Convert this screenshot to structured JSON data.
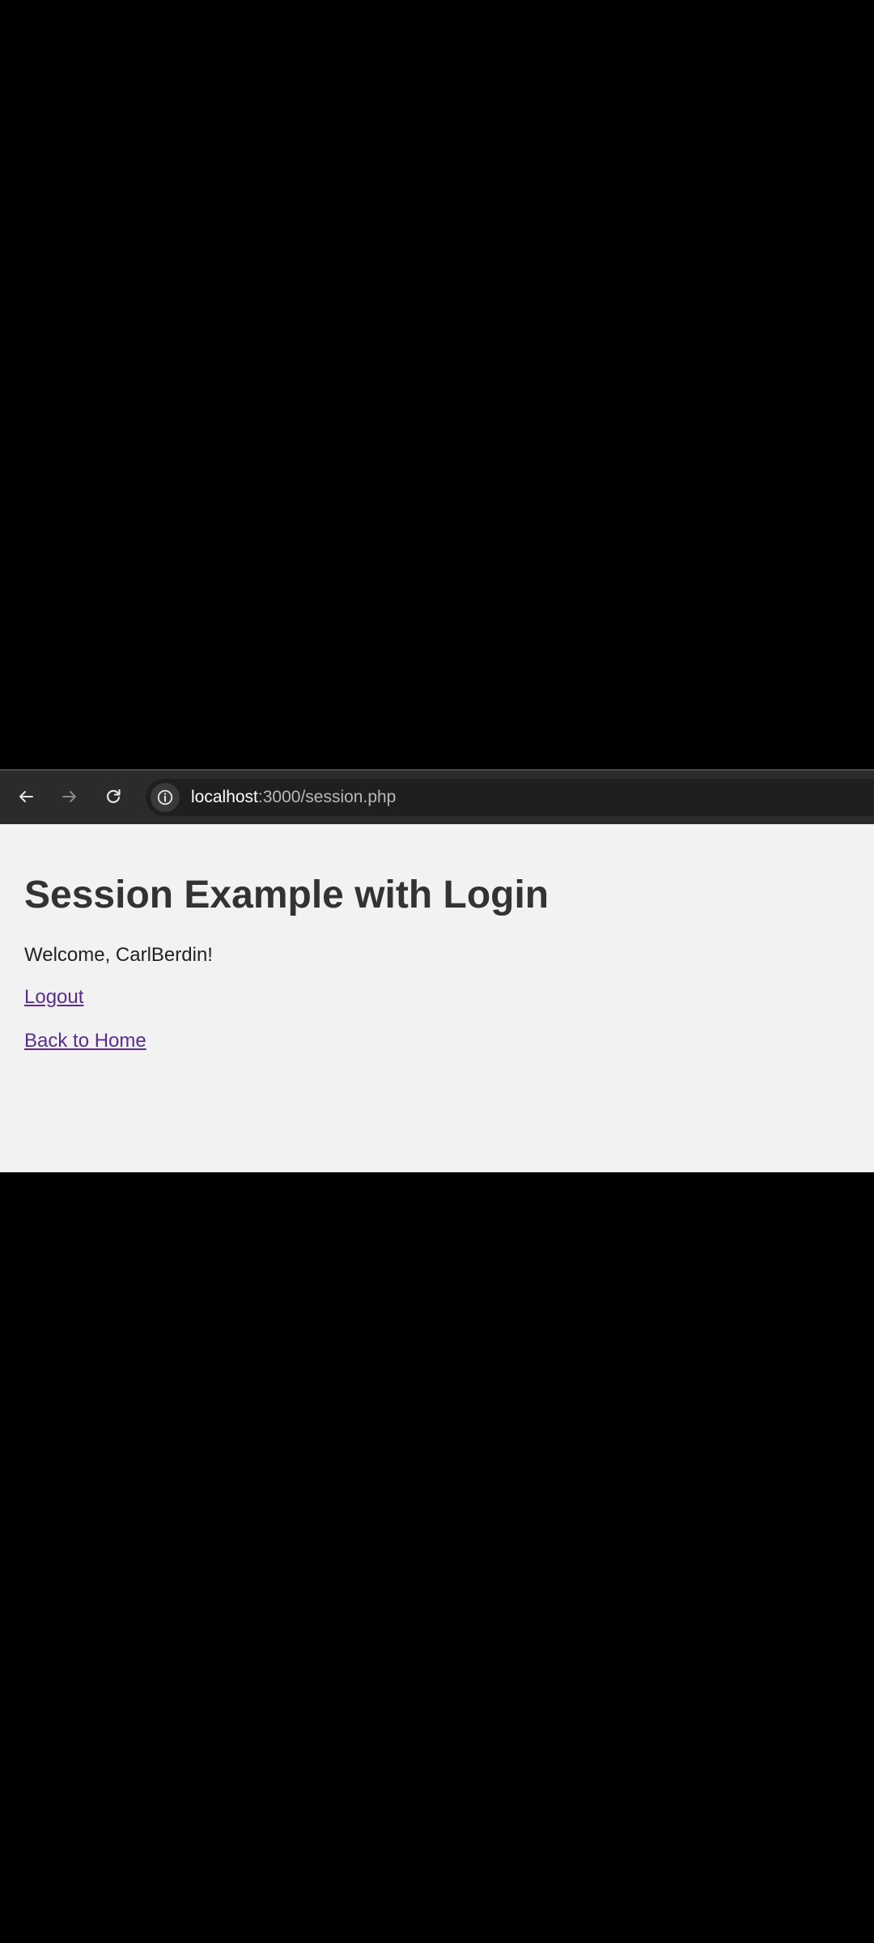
{
  "browser": {
    "url_host": "localhost",
    "url_rest": ":3000/session.php",
    "icons": {
      "back": "arrow-left-icon",
      "forward": "arrow-right-icon",
      "reload": "reload-icon",
      "site_info": "info-icon"
    }
  },
  "page": {
    "title": "Session Example with Login",
    "welcome": "Welcome, CarlBerdin!",
    "logout_link": "Logout",
    "home_link": "Back to Home"
  },
  "colors": {
    "toolbar": "#2b2b2b",
    "page_background": "#f2f2f2",
    "link": "#5b2d8e",
    "heading": "#333333"
  }
}
